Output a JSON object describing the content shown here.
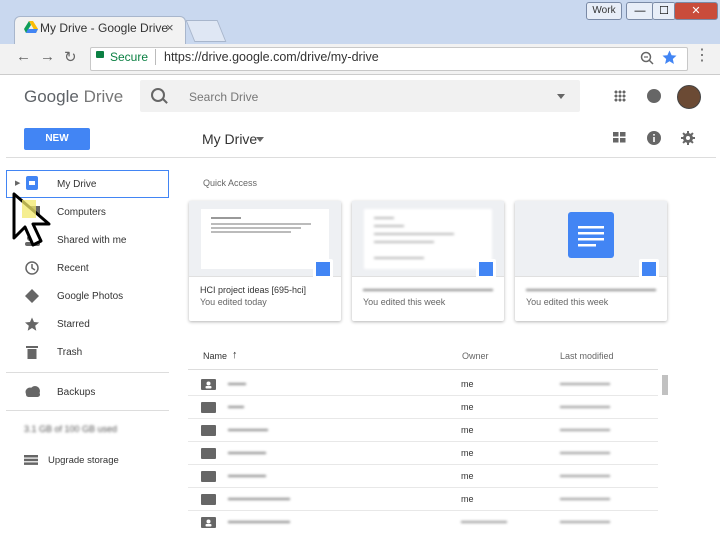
{
  "window": {
    "tab_title": "My Drive - Google Drive",
    "tab_close": "×",
    "profile": "Work",
    "min": "—",
    "max": "☐",
    "close": "✕"
  },
  "address": {
    "secure": "Secure",
    "url": "https://drive.google.com/drive/my-drive",
    "menu": "⋮"
  },
  "header": {
    "logo_google": "Google",
    "logo_drive": "Drive",
    "search_placeholder": "Search Drive",
    "new_label": "NEW",
    "page_title": "My Drive"
  },
  "sidebar": {
    "items": [
      {
        "label": "My Drive",
        "icon": "my-drive-icon"
      },
      {
        "label": "Computers",
        "icon": "computer-icon"
      },
      {
        "label": "Shared with me",
        "icon": "shared-icon"
      },
      {
        "label": "Recent",
        "icon": "clock-icon"
      },
      {
        "label": "Google Photos",
        "icon": "photos-icon"
      },
      {
        "label": "Starred",
        "icon": "star-icon"
      },
      {
        "label": "Trash",
        "icon": "trash-icon"
      },
      {
        "label": "Backups",
        "icon": "cloud-icon"
      }
    ],
    "storage": "3.1 GB of 100 GB used",
    "upgrade": "Upgrade storage"
  },
  "quick_access": {
    "title": "Quick Access",
    "cards": [
      {
        "name": "HCI project ideas [695-hci]",
        "sub": "You edited today"
      },
      {
        "name": "",
        "sub": "You edited this week"
      },
      {
        "name": "",
        "sub": "You edited this week"
      }
    ]
  },
  "files": {
    "headers": {
      "name": "Name",
      "sort_arrow": "↑",
      "owner": "Owner",
      "modified": "Last modified"
    },
    "rows": [
      {
        "owner": "me",
        "icon": "shared-folder-icon"
      },
      {
        "owner": "me",
        "icon": "folder-icon"
      },
      {
        "owner": "me",
        "icon": "folder-icon"
      },
      {
        "owner": "me",
        "icon": "folder-icon"
      },
      {
        "owner": "me",
        "icon": "folder-icon"
      },
      {
        "owner": "me",
        "icon": "folder-icon"
      },
      {
        "owner": "",
        "icon": "shared-folder-icon"
      }
    ]
  },
  "colors": {
    "accent": "#4285f4",
    "secure": "#0b8043"
  }
}
